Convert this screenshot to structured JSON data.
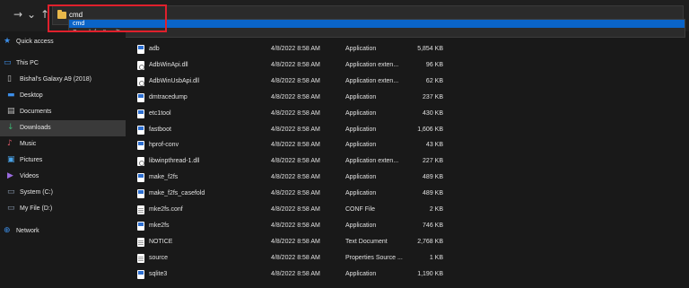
{
  "nav": {
    "back": "←",
    "forward": "→",
    "recent": "⌄",
    "up": "↑"
  },
  "address_bar": {
    "value": "cmd"
  },
  "autocomplete": {
    "selected": "cmd",
    "search": "Search for \"cmd\""
  },
  "sidebar": {
    "items": [
      {
        "label": "Quick access",
        "icon": "star-icon"
      },
      {
        "label": "This PC",
        "icon": "pc-icon"
      },
      {
        "label": "Bishal's Galaxy A9 (2018)",
        "icon": "phone-icon"
      },
      {
        "label": "Desktop",
        "icon": "desktop-icon"
      },
      {
        "label": "Documents",
        "icon": "documents-icon"
      },
      {
        "label": "Downloads",
        "icon": "downloads-icon"
      },
      {
        "label": "Music",
        "icon": "music-icon"
      },
      {
        "label": "Pictures",
        "icon": "pictures-icon"
      },
      {
        "label": "Videos",
        "icon": "videos-icon"
      },
      {
        "label": "System (C:)",
        "icon": "drive-icon"
      },
      {
        "label": "My File (D:)",
        "icon": "drive-icon"
      },
      {
        "label": "Network",
        "icon": "network-icon"
      }
    ]
  },
  "files": [
    {
      "name": "adb",
      "date": "4/8/2022 8:58 AM",
      "type": "Application",
      "size": "5,854 KB",
      "icon": "app"
    },
    {
      "name": "AdbWinApi.dll",
      "date": "4/8/2022 8:58 AM",
      "type": "Application exten...",
      "size": "96 KB",
      "icon": "dll"
    },
    {
      "name": "AdbWinUsbApi.dll",
      "date": "4/8/2022 8:58 AM",
      "type": "Application exten...",
      "size": "62 KB",
      "icon": "dll"
    },
    {
      "name": "dmtracedump",
      "date": "4/8/2022 8:58 AM",
      "type": "Application",
      "size": "237 KB",
      "icon": "app"
    },
    {
      "name": "etc1tool",
      "date": "4/8/2022 8:58 AM",
      "type": "Application",
      "size": "430 KB",
      "icon": "app"
    },
    {
      "name": "fastboot",
      "date": "4/8/2022 8:58 AM",
      "type": "Application",
      "size": "1,606 KB",
      "icon": "app"
    },
    {
      "name": "hprof-conv",
      "date": "4/8/2022 8:58 AM",
      "type": "Application",
      "size": "43 KB",
      "icon": "app"
    },
    {
      "name": "libwinpthread-1.dll",
      "date": "4/8/2022 8:58 AM",
      "type": "Application exten...",
      "size": "227 KB",
      "icon": "dll"
    },
    {
      "name": "make_f2fs",
      "date": "4/8/2022 8:58 AM",
      "type": "Application",
      "size": "489 KB",
      "icon": "app"
    },
    {
      "name": "make_f2fs_casefold",
      "date": "4/8/2022 8:58 AM",
      "type": "Application",
      "size": "489 KB",
      "icon": "app"
    },
    {
      "name": "mke2fs.conf",
      "date": "4/8/2022 8:58 AM",
      "type": "CONF File",
      "size": "2 KB",
      "icon": "doc"
    },
    {
      "name": "mke2fs",
      "date": "4/8/2022 8:58 AM",
      "type": "Application",
      "size": "746 KB",
      "icon": "app"
    },
    {
      "name": "NOTICE",
      "date": "4/8/2022 8:58 AM",
      "type": "Text Document",
      "size": "2,768 KB",
      "icon": "doc"
    },
    {
      "name": "source",
      "date": "4/8/2022 8:58 AM",
      "type": "Properties Source ...",
      "size": "1 KB",
      "icon": "doc"
    },
    {
      "name": "sqlite3",
      "date": "4/8/2022 8:58 AM",
      "type": "Application",
      "size": "1,190 KB",
      "icon": "app"
    }
  ],
  "colors": {
    "highlight_box": "#e0202c",
    "selection": "#0a64c8"
  }
}
